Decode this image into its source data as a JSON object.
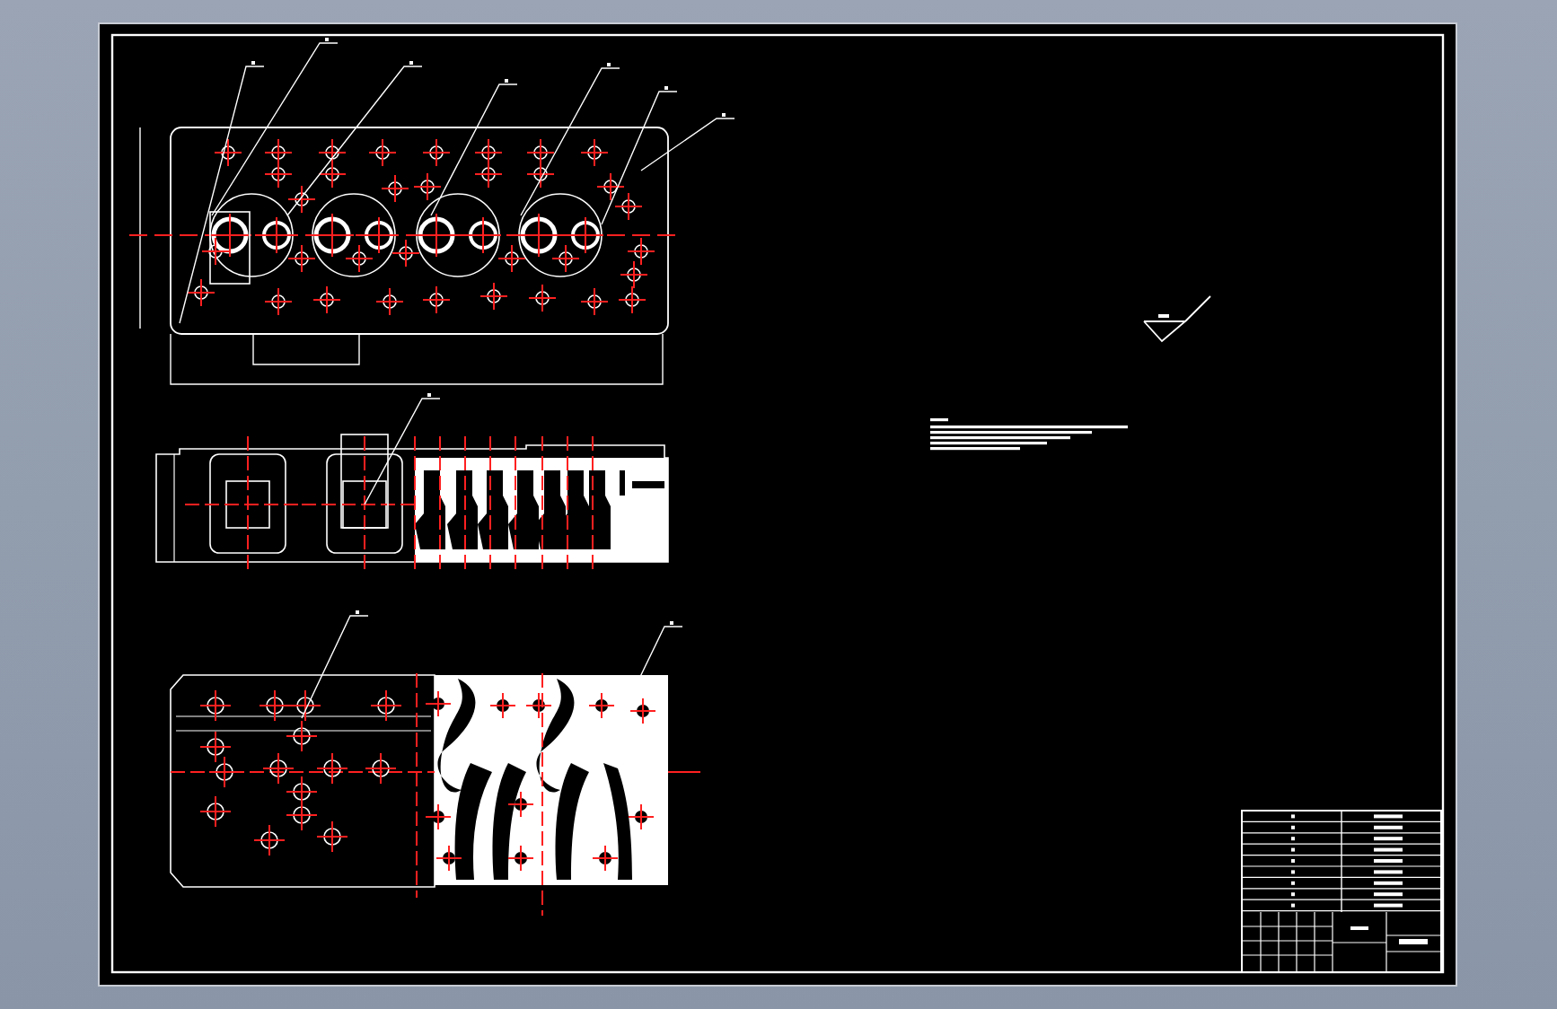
{
  "sheet": {
    "views": [
      {
        "kind": "plan"
      },
      {
        "kind": "elevation"
      },
      {
        "kind": "section"
      },
      {
        "kind": "roughness"
      },
      {
        "kind": "notes"
      },
      {
        "kind": "title_block"
      }
    ]
  }
}
